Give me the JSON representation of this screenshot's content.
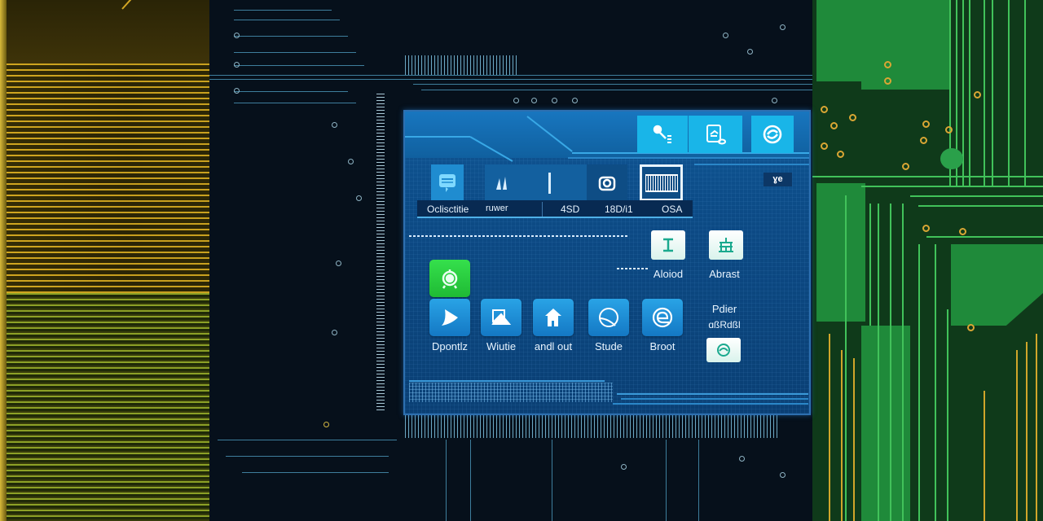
{
  "screen": {
    "top_buttons": [
      {
        "icon": "key-list-icon"
      },
      {
        "icon": "document-link-icon"
      },
      {
        "icon": "sync-icon"
      }
    ],
    "side_badge": "ɣe",
    "toolbar": {
      "items": [
        {
          "icon": "chat-bubble-icon",
          "label": "Oclisctitie"
        },
        {
          "icon": "audio-icon",
          "label": "ruwer"
        },
        {
          "icon": "bar-icon",
          "label": "4SD"
        },
        {
          "icon": "camera-icon",
          "label": "18D/i1"
        },
        {
          "icon": "barcode-icon",
          "label": "OSA"
        }
      ]
    },
    "apps": [
      {
        "icon": "play-icon",
        "label": "Dpontlz"
      },
      {
        "icon": "image-icon",
        "label": "Wiutie"
      },
      {
        "icon": "home-icon",
        "label": "andl out"
      },
      {
        "icon": "globe-icon",
        "label": "Stude"
      },
      {
        "icon": "browser-icon",
        "label": "Broot"
      }
    ],
    "green_app": {
      "icon": "settings-gear-icon"
    },
    "right_tiles": [
      {
        "icon": "text-cursor-icon",
        "label": "Aloiod"
      },
      {
        "icon": "network-icon",
        "label": "Abrast"
      }
    ],
    "right_text": {
      "line1": "Pdier",
      "line2": "ɑßRdßl"
    },
    "refresh_tile": {
      "icon": "refresh-icon"
    }
  },
  "colors": {
    "screen_bg": "#0b3f74",
    "accent": "#19b5e8",
    "green_tile": "#2ad043",
    "pcb_gold": "#e2b322",
    "pcb_green": "#1f8a3a",
    "pcb_dark": "#06101b"
  }
}
